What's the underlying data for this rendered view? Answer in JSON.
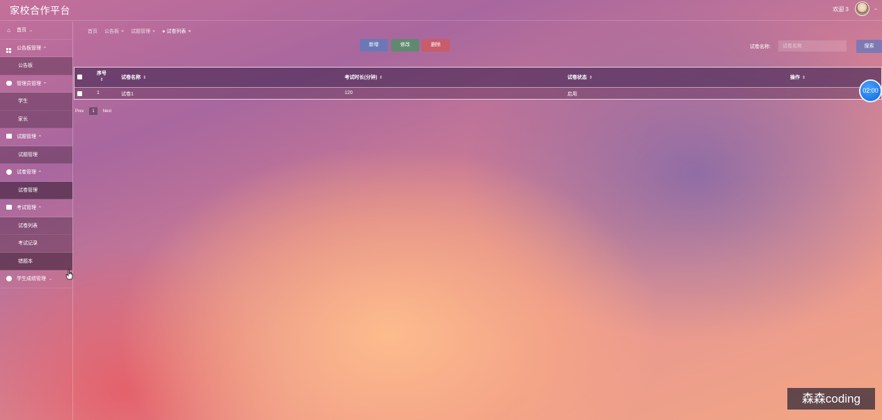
{
  "header": {
    "app_title": "家校合作平台",
    "welcome_text": "欢迎 3",
    "caret": "⌄"
  },
  "sidebar": {
    "items": [
      {
        "label": "首页",
        "icon": "home-icon",
        "caret": "⌄",
        "children": []
      },
      {
        "label": "公告板管理",
        "icon": "grid-icon",
        "caret": "^",
        "children": [
          "公告板"
        ]
      },
      {
        "label": "管理员管理",
        "icon": "admin-icon",
        "caret": "^",
        "children": [
          "学生",
          "家长"
        ]
      },
      {
        "label": "试题管理",
        "icon": "folder-icon",
        "caret": "^",
        "children": [
          "试题管理"
        ]
      },
      {
        "label": "试卷管理",
        "icon": "clock-icon",
        "caret": "^",
        "children": [
          "试卷管理"
        ]
      },
      {
        "label": "考试管理",
        "icon": "folder-icon",
        "caret": "^",
        "children": [
          "试卷列表",
          "考试记录",
          "错题本"
        ]
      },
      {
        "label": "学生成绩管理",
        "icon": "clock-icon",
        "caret": "⌄",
        "children": []
      }
    ]
  },
  "tabs": [
    {
      "label": "首页",
      "closable": false
    },
    {
      "label": "公告板",
      "closable": true
    },
    {
      "label": "试题管理",
      "closable": true
    },
    {
      "label": "● 试卷列表",
      "closable": true
    }
  ],
  "tab_close": "×",
  "toolbar": {
    "add_label": "新增",
    "edit_label": "修改",
    "delete_label": "删除",
    "search_label": "试卷名称:",
    "search_placeholder": "试卷名称",
    "search_button": "搜索",
    "colors": {
      "add": "#6b78b5",
      "edit": "#5f8a6f",
      "delete": "#c95b6a",
      "search": "#7e79b4"
    }
  },
  "table": {
    "headers": {
      "seq": "序号",
      "name": "试卷名称",
      "duration": "考试时长(分钟)",
      "status": "试卷状态",
      "actions": "操作"
    },
    "sort_glyph": "⇕",
    "rows": [
      {
        "seq": "1",
        "name": "试卷1",
        "duration": "120",
        "status": "启用",
        "actions": ""
      }
    ]
  },
  "pagination": {
    "prev": "Prev",
    "current_page": "1",
    "next": "Next"
  },
  "timer": "02:00",
  "watermark": "森森coding"
}
